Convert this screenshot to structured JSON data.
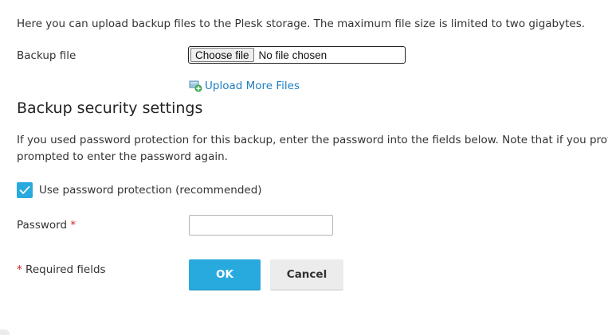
{
  "intro_text": "Here you can upload backup files to the Plesk storage. The maximum file size is limited to two gigabytes.",
  "backup_file": {
    "label": "Backup file",
    "choose_button": "Choose file",
    "status": "No file chosen"
  },
  "upload_more": {
    "icon": "upload-add-icon",
    "label": "Upload More Files"
  },
  "security": {
    "title": "Backup security settings",
    "description_line1": "If you used password protection for this backup, enter the password into the fields below. Note that if you provide",
    "description_line2": "prompted to enter the password again."
  },
  "password_protection": {
    "checked": true,
    "label": "Use password protection (recommended)"
  },
  "password": {
    "label": "Password",
    "required_mark": "*",
    "value": ""
  },
  "required_note": {
    "star": "*",
    "text": "Required fields"
  },
  "buttons": {
    "ok": "OK",
    "cancel": "Cancel"
  },
  "colors": {
    "accent": "#28aade",
    "link": "#1e7fbf",
    "required": "#d02020"
  }
}
